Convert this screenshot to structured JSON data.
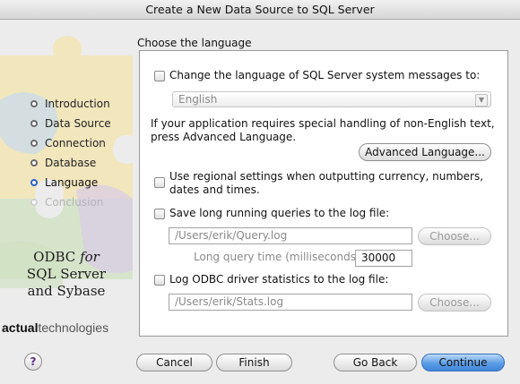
{
  "window": {
    "title": "Create a New Data Source to SQL Server"
  },
  "sidebar": {
    "steps": [
      {
        "label": "Introduction",
        "state": "done"
      },
      {
        "label": "Data Source",
        "state": "done"
      },
      {
        "label": "Connection",
        "state": "done"
      },
      {
        "label": "Database",
        "state": "done"
      },
      {
        "label": "Language",
        "state": "current"
      },
      {
        "label": "Conclusion",
        "state": "future"
      }
    ],
    "brand": {
      "line1": "ODBC",
      "line1_suffix": "for",
      "line2": "SQL Server",
      "line3": "and Sybase"
    },
    "company": {
      "bold": "actual",
      "rest": "technologies"
    }
  },
  "main": {
    "heading": "Choose the language",
    "change_language_label": "Change the language of SQL Server system messages to:",
    "language_value": "English",
    "special_text_1": "If your application requires special handling of non-English text,",
    "special_text_2": "press Advanced Language.",
    "advanced_language_button": "Advanced Language...",
    "regional_label_1": "Use regional settings when outputting currency, numbers,",
    "regional_label_2": "dates and times.",
    "long_queries_label": "Save long running queries to the log file:",
    "query_log_path": "/Users/erik/Query.log",
    "choose_button_1": "Choose...",
    "long_query_time_label": "Long query time (milliseconds):",
    "long_query_time_value": "30000",
    "stats_label": "Log ODBC driver statistics to the log file:",
    "stats_log_path": "/Users/erik/Stats.log",
    "choose_button_2": "Choose..."
  },
  "footer": {
    "help_label": "?",
    "cancel": "Cancel",
    "finish": "Finish",
    "go_back": "Go Back",
    "continue": "Continue"
  },
  "colors": {
    "accent": "#3f86dc",
    "current_step": "#2a62c8"
  }
}
